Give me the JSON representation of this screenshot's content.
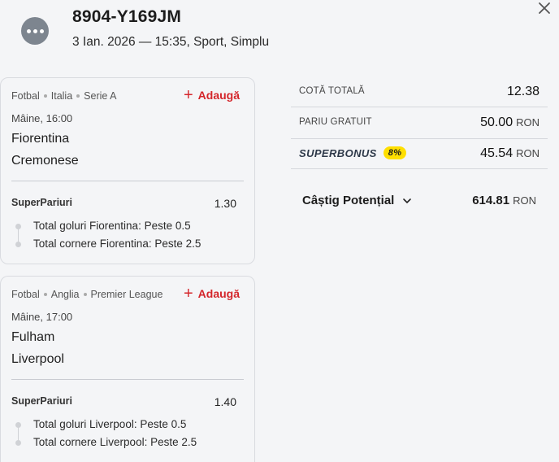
{
  "header": {
    "ticket_id": "8904-Y169JM",
    "meta": "3 Ian. 2026 — 15:35, Sport, Simplu"
  },
  "events": [
    {
      "crumbs": [
        "Fotbal",
        "Italia",
        "Serie A"
      ],
      "add_label": "Adaugă",
      "time": "Mâine, 16:00",
      "home": "Fiorentina",
      "away": "Cremonese",
      "market": "SuperPariuri",
      "odd": "1.30",
      "selections": [
        "Total goluri Fiorentina: Peste 0.5",
        "Total cornere Fiorentina: Peste 2.5"
      ]
    },
    {
      "crumbs": [
        "Fotbal",
        "Anglia",
        "Premier League"
      ],
      "add_label": "Adaugă",
      "time": "Mâine, 17:00",
      "home": "Fulham",
      "away": "Liverpool",
      "market": "SuperPariuri",
      "odd": "1.40",
      "selections": [
        "Total goluri Liverpool: Peste 0.5",
        "Total cornere Liverpool: Peste 2.5"
      ]
    }
  ],
  "summary": {
    "total_odds_label": "COTĂ TOTALĂ",
    "total_odds_value": "12.38",
    "free_bet_label": "PARIU GRATUIT",
    "free_bet_value": "50.00",
    "superbonus_label": "SUPERBONUS",
    "superbonus_badge": "8%",
    "superbonus_value": "45.54",
    "currency": "RON",
    "potential_label": "Câștig Potențial",
    "potential_value": "614.81"
  },
  "colors": {
    "accent_red": "#d4262b",
    "badge_yellow": "#ffdf00",
    "background": "#f4f5f7"
  }
}
